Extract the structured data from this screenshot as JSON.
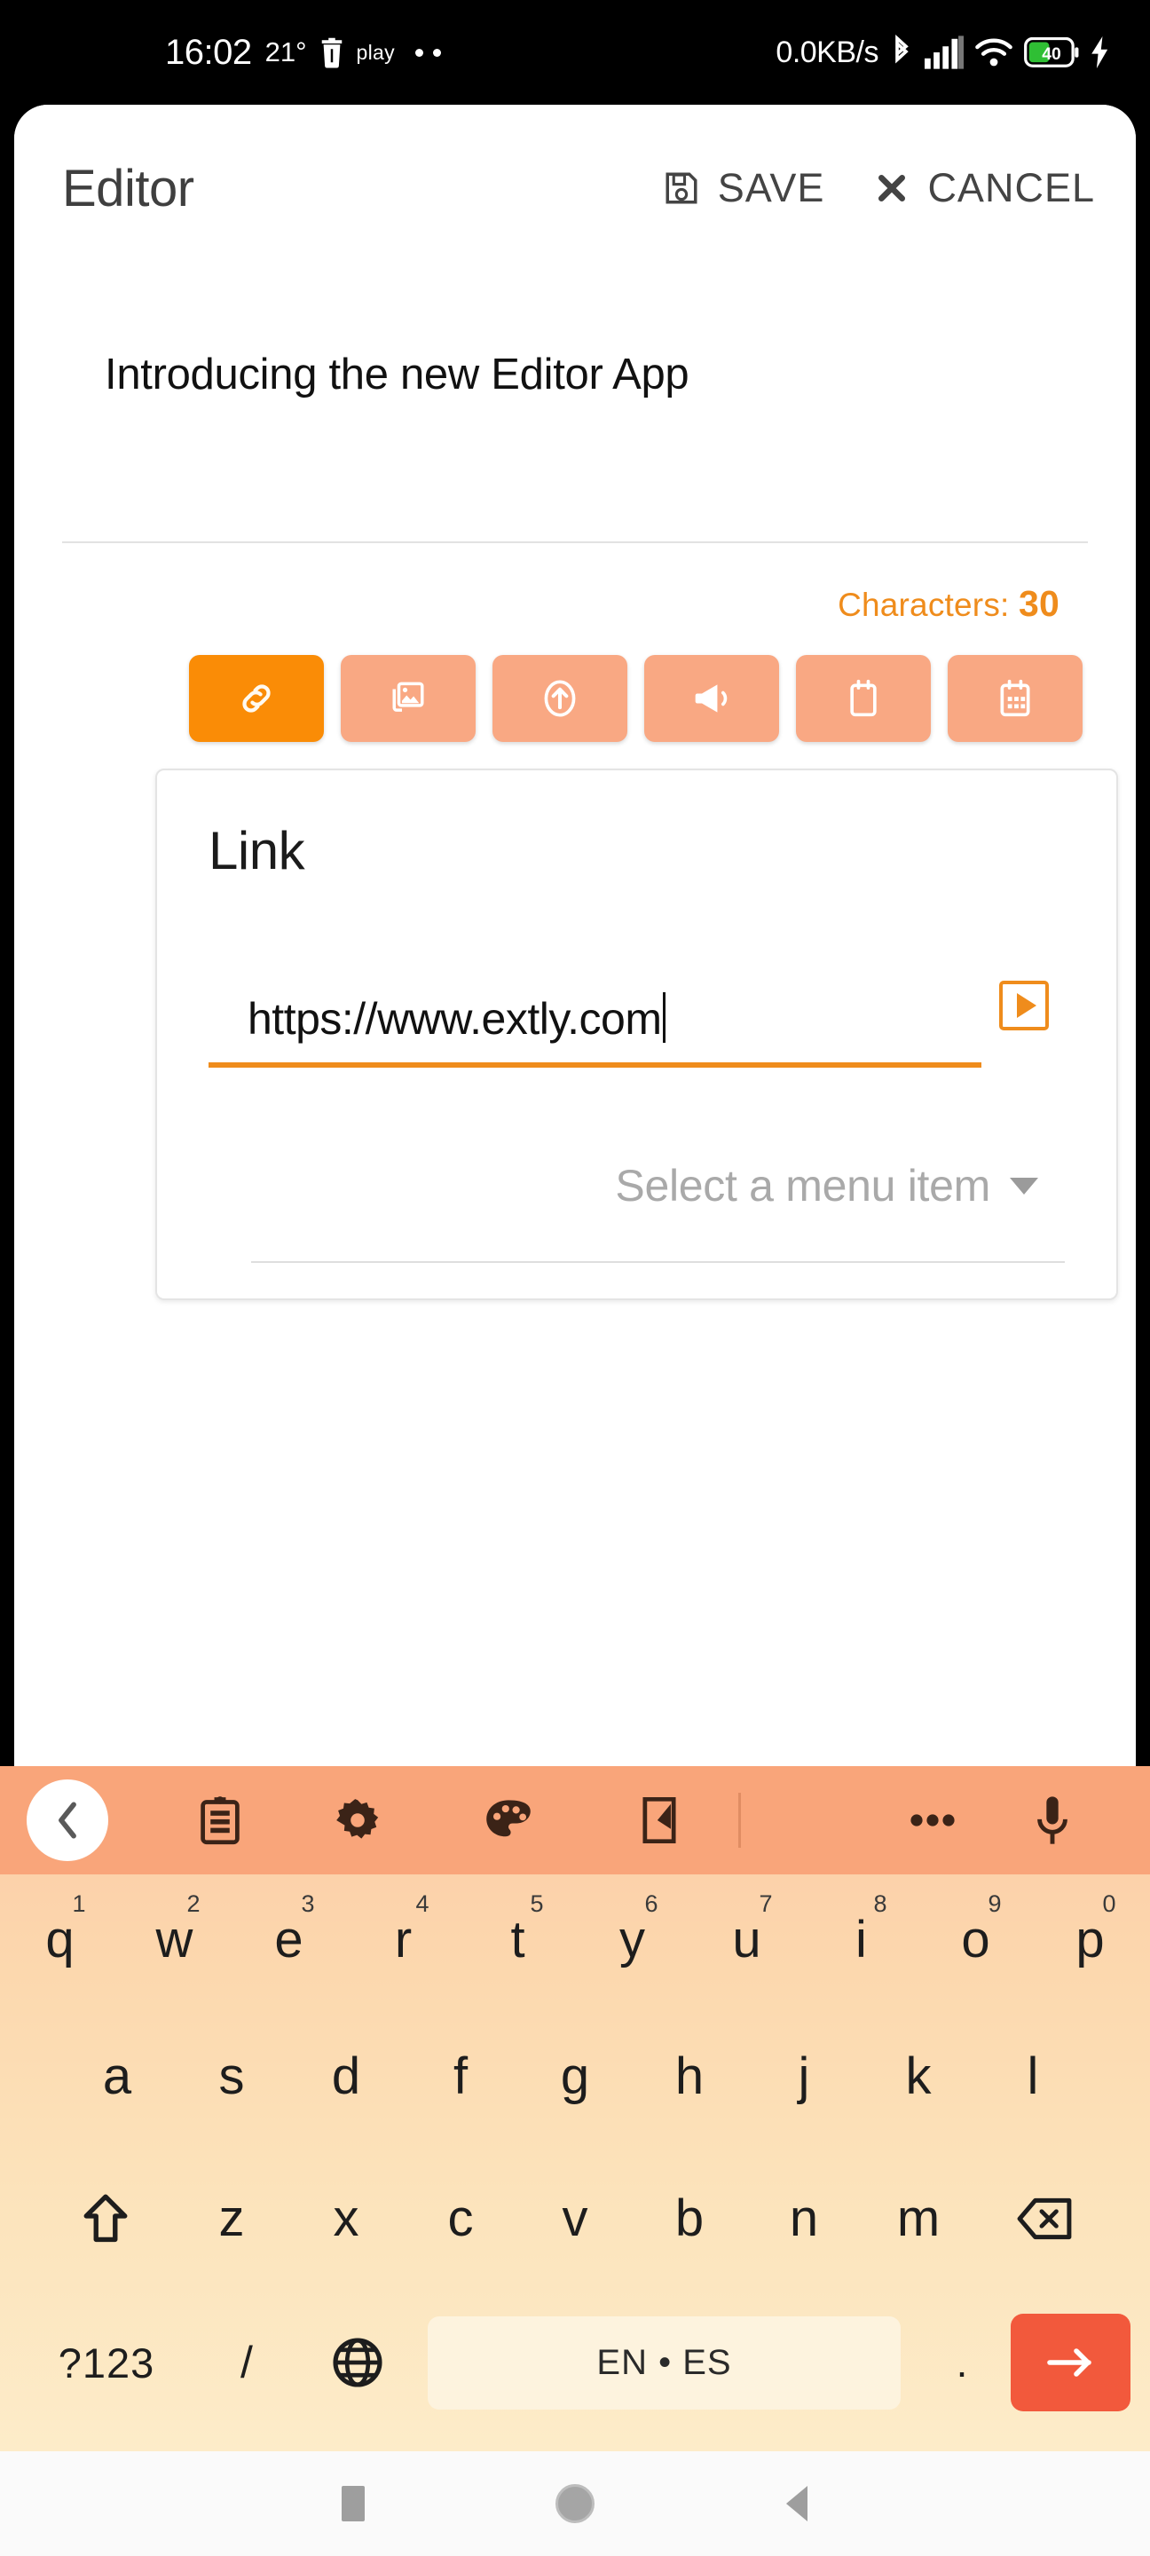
{
  "statusbar": {
    "time": "16:02",
    "temperature": "21°",
    "play_label": "play",
    "network_speed": "0.0KB/s",
    "battery_level": "40",
    "icons": [
      "trash-icon",
      "bluetooth-icon",
      "signal-icon",
      "wifi-icon",
      "battery-icon",
      "charging-bolt-icon"
    ]
  },
  "appbar": {
    "title": "Editor",
    "save_label": "SAVE",
    "cancel_label": "CANCEL"
  },
  "editor": {
    "document_title": "Introducing the new Editor App",
    "characters_label": "Characters:",
    "characters_count": "30",
    "accent_color": "#ef8c1c",
    "toolbar": [
      {
        "name": "link-icon",
        "label": "Link",
        "active": true
      },
      {
        "name": "gallery-icon",
        "label": "Images",
        "active": false
      },
      {
        "name": "upload-icon",
        "label": "Upload",
        "active": false
      },
      {
        "name": "megaphone-icon",
        "label": "Announcement",
        "active": false
      },
      {
        "name": "note-icon",
        "label": "Note",
        "active": false
      },
      {
        "name": "calendar-icon",
        "label": "Calendar",
        "active": false
      }
    ]
  },
  "link_card": {
    "title": "Link",
    "url_value": "https://www.extly.com",
    "url_placeholder": "https://",
    "select_placeholder": "Select a menu item"
  },
  "keyboard": {
    "toolbar_icons": [
      "back-chevron-icon",
      "clipboard-icon",
      "gear-icon",
      "palette-icon",
      "handwriting-icon",
      "more-options-icon",
      "microphone-icon"
    ],
    "row1": [
      {
        "key": "q",
        "num": "1"
      },
      {
        "key": "w",
        "num": "2"
      },
      {
        "key": "e",
        "num": "3"
      },
      {
        "key": "r",
        "num": "4"
      },
      {
        "key": "t",
        "num": "5"
      },
      {
        "key": "y",
        "num": "6"
      },
      {
        "key": "u",
        "num": "7"
      },
      {
        "key": "i",
        "num": "8"
      },
      {
        "key": "o",
        "num": "9"
      },
      {
        "key": "p",
        "num": "0"
      }
    ],
    "row2": [
      "a",
      "s",
      "d",
      "f",
      "g",
      "h",
      "j",
      "k",
      "l"
    ],
    "row3": [
      "z",
      "x",
      "c",
      "v",
      "b",
      "n",
      "m"
    ],
    "shift_icon": "shift-icon",
    "backspace_icon": "backspace-icon",
    "symbols_label": "?123",
    "slash_label": "/",
    "globe_icon": "globe-icon",
    "spacebar_label": "EN • ES",
    "period_label": ".",
    "enter_icon": "enter-arrow-icon",
    "enter_color": "#F2593C"
  },
  "navbar": {
    "recents_label": "Recents",
    "home_label": "Home",
    "back_label": "Back"
  }
}
